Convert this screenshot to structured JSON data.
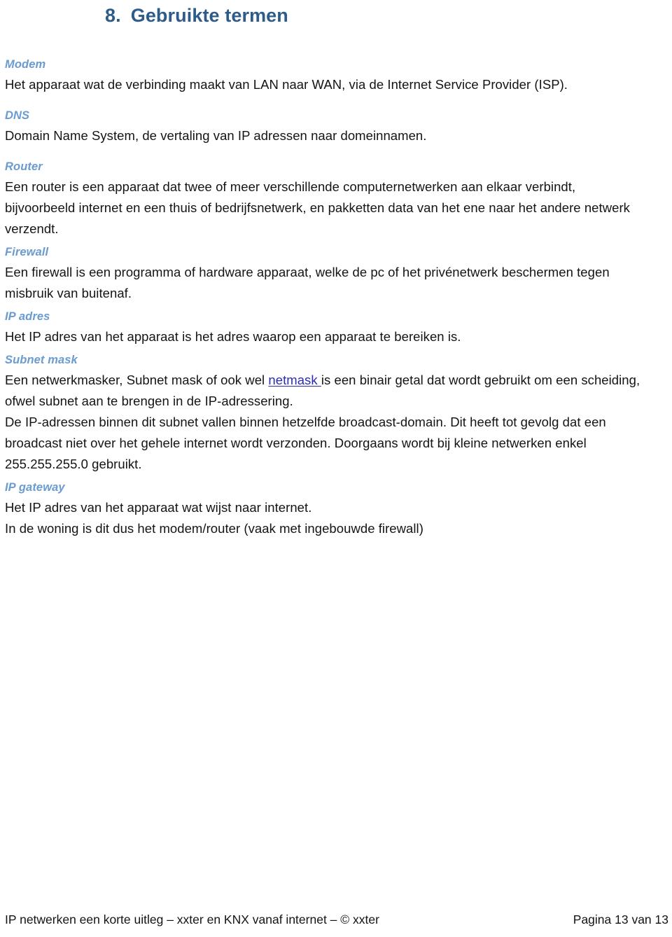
{
  "document": {
    "chapter_number": "8.",
    "chapter_title": "Gebruikte termen"
  },
  "terms": [
    {
      "heading": "Modem",
      "paragraphs": [
        "Het apparaat wat de verbinding maakt van LAN naar WAN, via de Internet Service Provider (ISP)."
      ]
    },
    {
      "heading": "DNS",
      "paragraphs": [
        "Domain Name System, de vertaling van IP adressen naar domeinnamen."
      ]
    },
    {
      "heading": "Router",
      "paragraphs": [
        "Een router is een apparaat dat twee of meer verschillende computernetwerken aan elkaar verbindt, bijvoorbeeld internet en een thuis of bedrijfsnetwerk, en pakketten data van het ene naar het andere netwerk verzendt."
      ]
    },
    {
      "heading": "Firewall",
      "paragraphs": [
        "Een firewall is een programma of hardware apparaat, welke de pc of het privénetwerk beschermen tegen misbruik van buitenaf."
      ]
    },
    {
      "heading": "IP adres",
      "paragraphs": [
        "Het IP adres van het apparaat is het adres waarop een apparaat te bereiken is."
      ]
    },
    {
      "heading": "Subnet mask",
      "paragraphs": [
        {
          "before_link": "Een netwerkmasker, Subnet mask of ook wel ",
          "link_text": "netmask ",
          "after_link": "is een binair getal dat wordt gebruikt om een scheiding, ofwel subnet aan te brengen in de IP-adressering."
        },
        "De IP-adressen binnen dit subnet vallen binnen hetzelfde broadcast-domain. Dit heeft tot gevolg dat een broadcast niet over het gehele internet wordt verzonden. Doorgaans wordt bij kleine netwerken enkel 255.255.255.0 gebruikt."
      ]
    },
    {
      "heading": "IP gateway",
      "paragraphs": [
        "Het IP adres van het apparaat wat wijst naar internet.",
        "In de woning is dit dus het modem/router (vaak met ingebouwde firewall)"
      ]
    }
  ],
  "footer": {
    "left": "IP netwerken een korte uitleg – xxter en KNX vanaf internet – © xxter",
    "right": "Pagina 13 van 13"
  },
  "colors": {
    "chapter_heading": "#2e5c8a",
    "term_heading": "#6a9bd1",
    "body_text": "#141414",
    "link": "#2b2bb5",
    "page_background": "#ffffff"
  }
}
